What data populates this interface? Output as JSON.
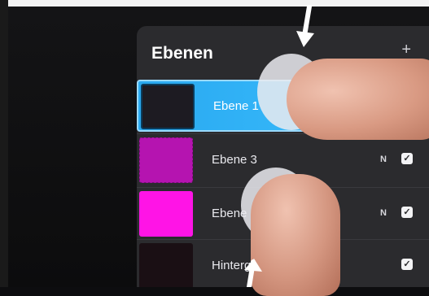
{
  "panel": {
    "title": "Ebenen",
    "add_label": "+"
  },
  "layers": [
    {
      "label": "Ebene 1",
      "blend": "",
      "visible": true,
      "selected": true,
      "thumb_color": "#1d1b22"
    },
    {
      "label": "Ebene 3",
      "blend": "N",
      "visible": true,
      "selected": false,
      "thumb_color": "#b514b0"
    },
    {
      "label": "Ebene 2",
      "blend": "N",
      "visible": true,
      "selected": false,
      "thumb_color": "#ff14e6"
    },
    {
      "label": "Hintergrundfarbe",
      "blend": "",
      "visible": true,
      "selected": false,
      "thumb_color": "#1a0f14"
    }
  ],
  "colors": {
    "selected_row": "#2aa9f0",
    "panel_bg": "#2b2b2e",
    "magenta": "#ff14e6"
  },
  "icons": {
    "checkbox": "check-icon",
    "arrow": "down-arrow-icon"
  }
}
